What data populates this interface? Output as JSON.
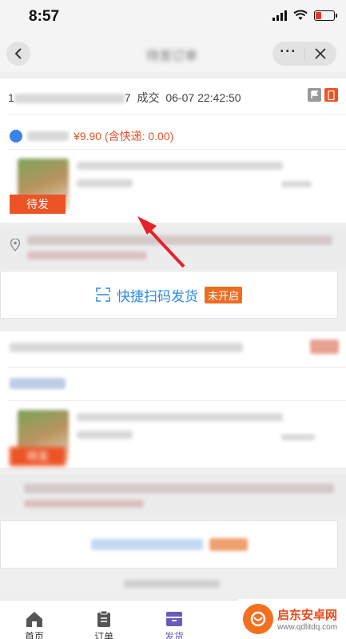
{
  "status_bar": {
    "time": "8:57"
  },
  "nav": {
    "title": "待发订单"
  },
  "order1": {
    "id_prefix": "1",
    "id_suffix": "7",
    "deal_label": "成交",
    "deal_time": "06-07 22:42:50",
    "price": "¥9.90 (含快递: 0.00)",
    "status_tag": "待发",
    "scan_label": "快捷扫码发货",
    "scan_badge": "未开启"
  },
  "order2": {
    "status_tag": "待发"
  },
  "tabs": [
    {
      "label": "首页",
      "icon": "home-icon"
    },
    {
      "label": "订单",
      "icon": "clipboard-icon"
    },
    {
      "label": "发货",
      "icon": "box-icon"
    }
  ],
  "watermark": {
    "cn": "启东安卓网",
    "url": "www.qdlitdq.com"
  },
  "colors": {
    "accent_orange": "#ec5426",
    "link_blue": "#2b8be8",
    "tab_active": "#6b5bb8",
    "price_red": "#e4542c"
  }
}
